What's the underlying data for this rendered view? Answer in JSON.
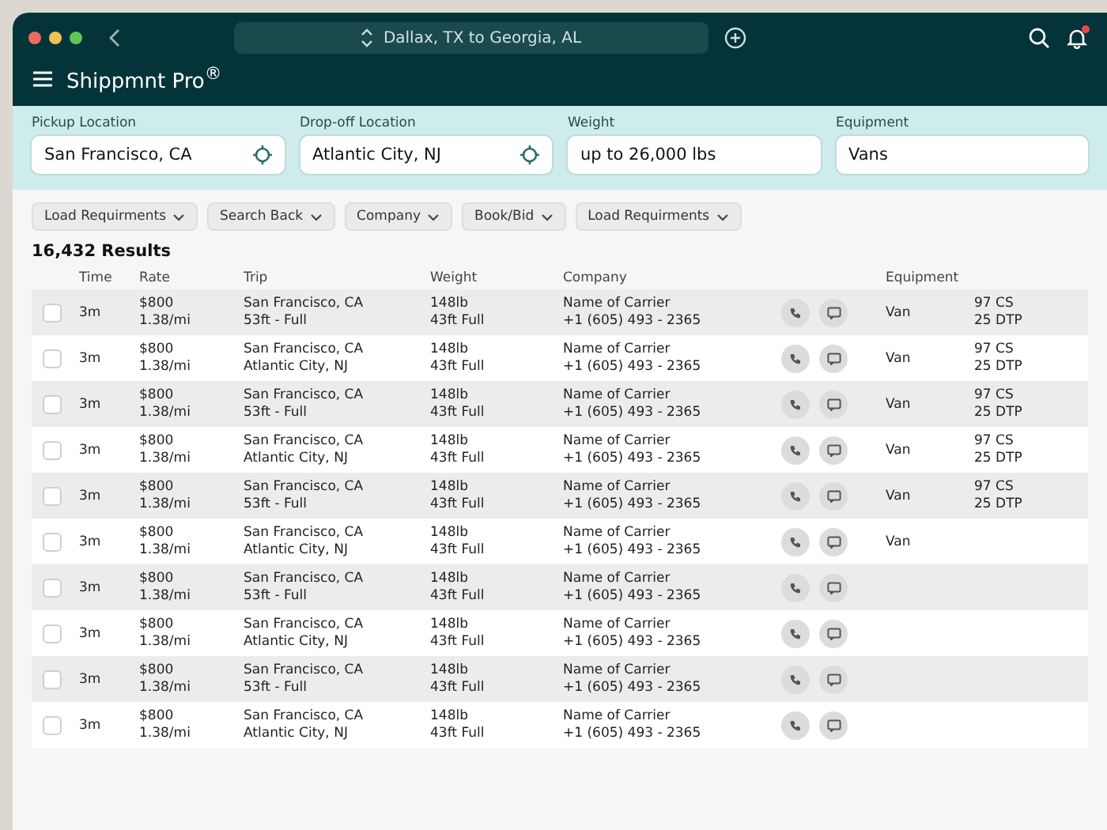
{
  "window": {
    "brand": "Shippmnt Pro$^{®}$",
    "route_search": "Dallax, TX to Georgia, AL",
    "notification_dot": true
  },
  "filters": [
    {
      "label": "Pickup Location",
      "value": "San Francisco, CA",
      "locate": true
    },
    {
      "label": "Drop-off Location",
      "value": "Atlantic City, NJ",
      "locate": true
    },
    {
      "label": "Weight",
      "value": "up to 26,000 lbs",
      "locate": false
    },
    {
      "label": "Equipment",
      "value": "Vans",
      "locate": false
    }
  ],
  "chips": [
    "Load Requirments",
    "Search Back",
    "Company",
    "Book/Bid",
    "Load Requirments"
  ],
  "results": "16,432 Results",
  "table": {
    "columns": [
      "Time",
      "Rate",
      "Trip",
      "Weight",
      "Company",
      "Equipment"
    ],
    "rows": [
      {
        "checked": false,
        "time": "3m",
        "rate": "$800",
        "rate_per_mile": "1.38/mi",
        "trip": "San Francisco, CA",
        "trip_detail": "53ft - Full",
        "weight": "148lb",
        "weight_detail": "43ft Full",
        "carrier": "Name of Carrier",
        "phone": "+1 (605) 493 - 2365",
        "equipment": "Van",
        "capacity": [
          "97 CS",
          "25 DTP"
        ]
      },
      {
        "checked": false,
        "time": "3m",
        "rate": "$800",
        "rate_per_mile": "1.38/mi",
        "trip": "San Francisco, CA",
        "trip_detail": "Atlantic City, NJ",
        "weight": "148lb",
        "weight_detail": "43ft Full",
        "carrier": "Name of Carrier",
        "phone": "+1 (605) 493 - 2365",
        "equipment": "Van",
        "capacity": [
          "97 CS",
          "25 DTP"
        ]
      },
      {
        "checked": false,
        "time": "3m",
        "rate": "$800",
        "rate_per_mile": "1.38/mi",
        "trip": "San Francisco, CA",
        "trip_detail": "53ft - Full",
        "weight": "148lb",
        "weight_detail": "43ft Full",
        "carrier": "Name of Carrier",
        "phone": "+1 (605) 493 - 2365",
        "equipment": "Van",
        "capacity": [
          "97 CS",
          "25 DTP"
        ]
      },
      {
        "checked": false,
        "time": "3m",
        "rate": "$800",
        "rate_per_mile": "1.38/mi",
        "trip": "San Francisco, CA",
        "trip_detail": "Atlantic City, NJ",
        "weight": "148lb",
        "weight_detail": "43ft Full",
        "carrier": "Name of Carrier",
        "phone": "+1 (605) 493 - 2365",
        "equipment": "Van",
        "capacity": [
          "97 CS",
          "25 DTP"
        ]
      },
      {
        "checked": false,
        "time": "3m",
        "rate": "$800",
        "rate_per_mile": "1.38/mi",
        "trip": "San Francisco, CA",
        "trip_detail": "53ft - Full",
        "weight": "148lb",
        "weight_detail": "43ft Full",
        "carrier": "Name of Carrier",
        "phone": "+1 (605) 493 - 2365",
        "equipment": "Van",
        "capacity": [
          "97 CS",
          "25 DTP"
        ]
      },
      {
        "checked": false,
        "time": "3m",
        "rate": "$800",
        "rate_per_mile": "1.38/mi",
        "trip": "San Francisco, CA",
        "trip_detail": "Atlantic City, NJ",
        "weight": "148lb",
        "weight_detail": "43ft Full",
        "carrier": "Name of Carrier",
        "phone": "+1 (605) 493 - 2365",
        "equipment": "Van",
        "capacity": []
      },
      {
        "checked": false,
        "time": "3m",
        "rate": "$800",
        "rate_per_mile": "1.38/mi",
        "trip": "San Francisco, CA",
        "trip_detail": "53ft - Full",
        "weight": "148lb",
        "weight_detail": "43ft Full",
        "carrier": "Name of Carrier",
        "phone": "+1 (605) 493 - 2365",
        "capacity": []
      },
      {
        "checked": false,
        "time": "3m",
        "rate": "$800",
        "rate_per_mile": "1.38/mi",
        "trip": "San Francisco, CA",
        "trip_detail": "Atlantic City, NJ",
        "weight": "148lb",
        "weight_detail": "43ft Full",
        "carrier": "Name of Carrier",
        "phone": "+1 (605) 493 - 2365",
        "capacity": []
      },
      {
        "checked": false,
        "time": "3m",
        "rate": "$800",
        "rate_per_mile": "1.38/mi",
        "trip": "San Francisco, CA",
        "trip_detail": "53ft - Full",
        "weight": "148lb",
        "weight_detail": "43ft Full",
        "carrier": "Name of Carrier",
        "phone": "+1 (605) 493 - 2365",
        "capacity": []
      },
      {
        "checked": false,
        "time": "3m",
        "rate": "$800",
        "rate_per_mile": "1.38/mi",
        "trip": "San Francisco, CA",
        "trip_detail": "Atlantic City, NJ",
        "weight": "148lb",
        "weight_detail": "43ft Full",
        "carrier": "Name of Carrier",
        "phone": "+1 (605) 493 - 2365",
        "capacity": []
      }
    ]
  }
}
